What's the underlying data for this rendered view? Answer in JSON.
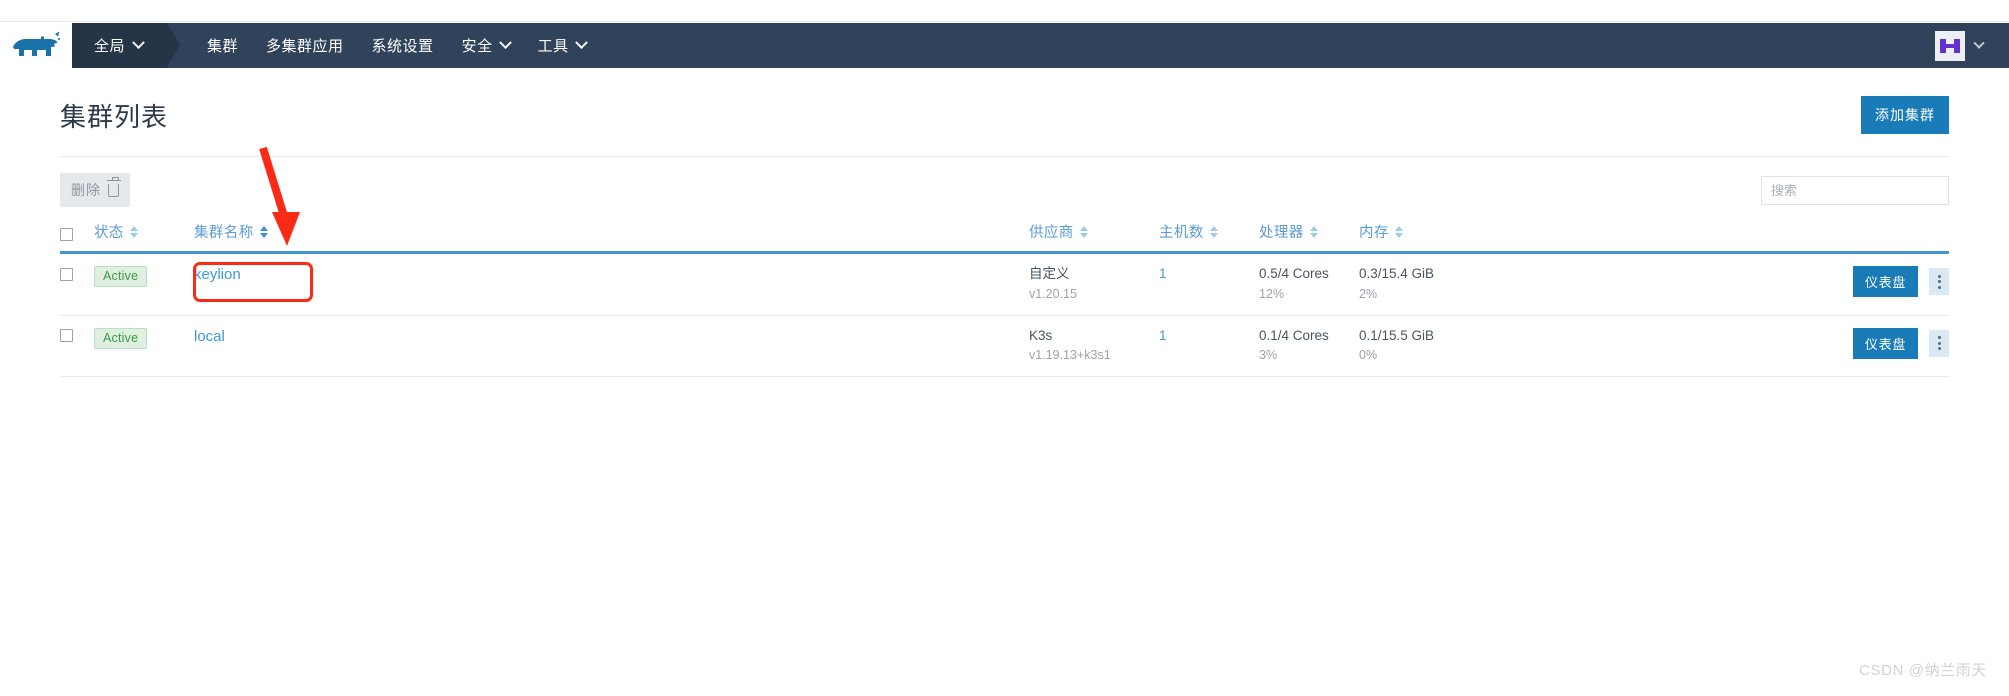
{
  "navbar": {
    "logo_icon": "cow-logo-icon",
    "active_item": {
      "label": "全局",
      "icon": "chevron-down-icon"
    },
    "items": [
      {
        "label": "集群",
        "has_chevron": false
      },
      {
        "label": "多集群应用",
        "has_chevron": false
      },
      {
        "label": "系统设置",
        "has_chevron": false
      },
      {
        "label": "安全",
        "has_chevron": true
      },
      {
        "label": "工具",
        "has_chevron": true
      }
    ],
    "user": {
      "avatar_icon": "user-avatar-icon",
      "chevron_icon": "chevron-down-icon"
    },
    "bg_color": "#30435a",
    "active_bg_color": "#263447"
  },
  "header": {
    "title": "集群列表",
    "add_button": "添加集群"
  },
  "toolbar": {
    "delete_label": "删除",
    "delete_icon": "trash-icon",
    "search_placeholder": "搜索",
    "search_value": ""
  },
  "table": {
    "columns": [
      {
        "key": "checkbox",
        "label": "",
        "sortable": false
      },
      {
        "key": "state",
        "label": "状态",
        "sortable": true,
        "active": false
      },
      {
        "key": "name",
        "label": "集群名称",
        "sortable": true,
        "active": true
      },
      {
        "key": "provider",
        "label": "供应商",
        "sortable": true,
        "active": false
      },
      {
        "key": "nodes",
        "label": "主机数",
        "sortable": true,
        "active": false
      },
      {
        "key": "cpu",
        "label": "处理器",
        "sortable": true,
        "active": false
      },
      {
        "key": "memory",
        "label": "内存",
        "sortable": true,
        "active": false
      },
      {
        "key": "actions",
        "label": "",
        "sortable": false
      }
    ],
    "rows": [
      {
        "checked": false,
        "state": "Active",
        "name": "keylion",
        "provider": "自定义",
        "provider_version": "v1.20.15",
        "nodes": "1",
        "cpu": "0.5/4 Cores",
        "cpu_pct": "12%",
        "memory": "0.3/15.4 GiB",
        "memory_pct": "2%",
        "dashboard_label": "仪表盘",
        "menu_icon": "kebab-menu-icon",
        "highlighted": true
      },
      {
        "checked": false,
        "state": "Active",
        "name": "local",
        "provider": "K3s",
        "provider_version": "v1.19.13+k3s1",
        "nodes": "1",
        "cpu": "0.1/4 Cores",
        "cpu_pct": "3%",
        "memory": "0.1/15.5 GiB",
        "memory_pct": "0%",
        "dashboard_label": "仪表盘",
        "menu_icon": "kebab-menu-icon",
        "highlighted": false
      }
    ]
  },
  "annotations": {
    "arrow_color": "#fa2a16",
    "highlight_box_color": "#fa2a16"
  },
  "watermark": "CSDN @纳兰雨天",
  "colors": {
    "primary": "#1a7bb9",
    "header_link": "#5b9bd5",
    "link": "#3d9ad4",
    "badge_bg": "#dff0e0",
    "badge_text": "#3d9a47",
    "table_rule": "#4096d2"
  }
}
